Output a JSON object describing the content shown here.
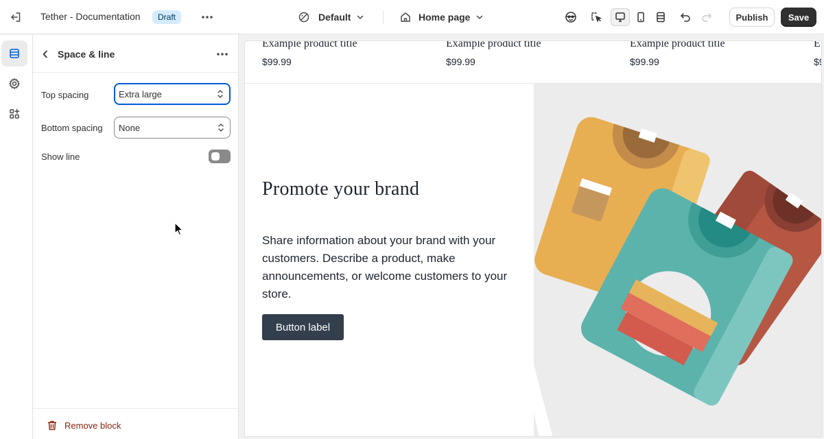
{
  "topbar": {
    "store_title": "Tether - Documentation",
    "status_badge": "Draft",
    "theme_selector": "Default",
    "page_selector": "Home page",
    "publish_label": "Publish",
    "save_label": "Save"
  },
  "rail": {
    "items": [
      {
        "icon": "sections-icon",
        "active": true
      },
      {
        "icon": "gear-icon",
        "active": false
      },
      {
        "icon": "apps-icon",
        "active": false
      }
    ]
  },
  "panel": {
    "title": "Space & line",
    "fields": {
      "top_spacing": {
        "label": "Top spacing",
        "value": "Extra large"
      },
      "bottom_spacing": {
        "label": "Bottom spacing",
        "value": "None"
      },
      "show_line": {
        "label": "Show line",
        "checked": false
      }
    },
    "remove_label": "Remove block"
  },
  "preview": {
    "products": [
      {
        "title": "Example product title",
        "price": "$99.99"
      },
      {
        "title": "Example product title",
        "price": "$99.99"
      },
      {
        "title": "Example product title",
        "price": "$99.99"
      },
      {
        "title": "E",
        "price": "$9"
      }
    ],
    "brand": {
      "heading": "Promote your brand",
      "text": "Share information about your brand with your customers. Describe a product, make announcements, or welcome customers to your store.",
      "button_label": "Button label"
    }
  },
  "colors": {
    "accent_focus": "#005bd3",
    "danger": "#8e1f0b",
    "badge_bg": "#d5ebff",
    "save_bg": "#303030",
    "brand_button": "#333f4c"
  }
}
